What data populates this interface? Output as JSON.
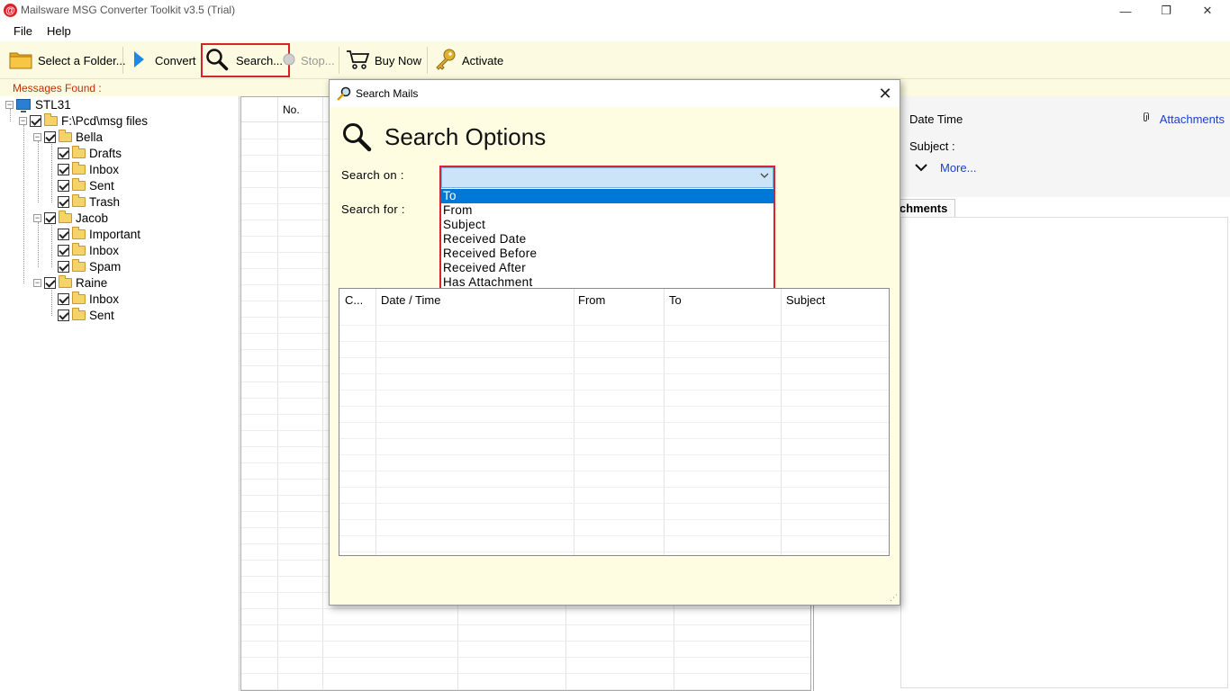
{
  "window": {
    "title": "Mailsware MSG Converter Toolkit v3.5 (Trial)",
    "app_icon_glyph": "@",
    "minimize": "—",
    "maximize": "❐",
    "close": "✕"
  },
  "menu": {
    "items": [
      "File",
      "Help"
    ]
  },
  "toolbar": {
    "select_folder": "Select a Folder...",
    "convert": "Convert",
    "search": "Search...",
    "stop": "Stop...",
    "buy_now": "Buy Now",
    "activate": "Activate"
  },
  "status": {
    "messages_found": "Messages Found :"
  },
  "tree": {
    "root": "STL31",
    "path": "F:\\Pcd\\msg files",
    "users": [
      {
        "name": "Bella",
        "folders": [
          "Drafts",
          "Inbox",
          "Sent",
          "Trash"
        ]
      },
      {
        "name": "Jacob",
        "folders": [
          "Important",
          "Inbox",
          "Spam"
        ]
      },
      {
        "name": "Raine",
        "folders": [
          "Inbox",
          "Sent"
        ]
      }
    ]
  },
  "grid": {
    "col_no": "No."
  },
  "preview": {
    "date_time": "Date Time",
    "attachments": "Attachments",
    "subject": "Subject :",
    "more": "More...",
    "tab_attachments": "ttachments"
  },
  "dialog": {
    "title": "Search Mails",
    "close": "✕",
    "heading": "Search Options",
    "search_on_label": "Search on :",
    "search_for_label": "Search for :",
    "search_on_value": "",
    "options": [
      "To",
      "From",
      "Subject",
      "Received Date",
      "Received Before",
      "Received After",
      "Has Attachment"
    ],
    "selected_option": "To",
    "results_columns": [
      "C...",
      "Date / Time",
      "From",
      "To",
      "Subject"
    ]
  },
  "colors": {
    "accent_red": "#d8232a",
    "toolbar_bg": "#fcfae0",
    "dialog_bg": "#fefde2",
    "selection_blue": "#0078d7",
    "link_blue": "#1a3fcf"
  }
}
